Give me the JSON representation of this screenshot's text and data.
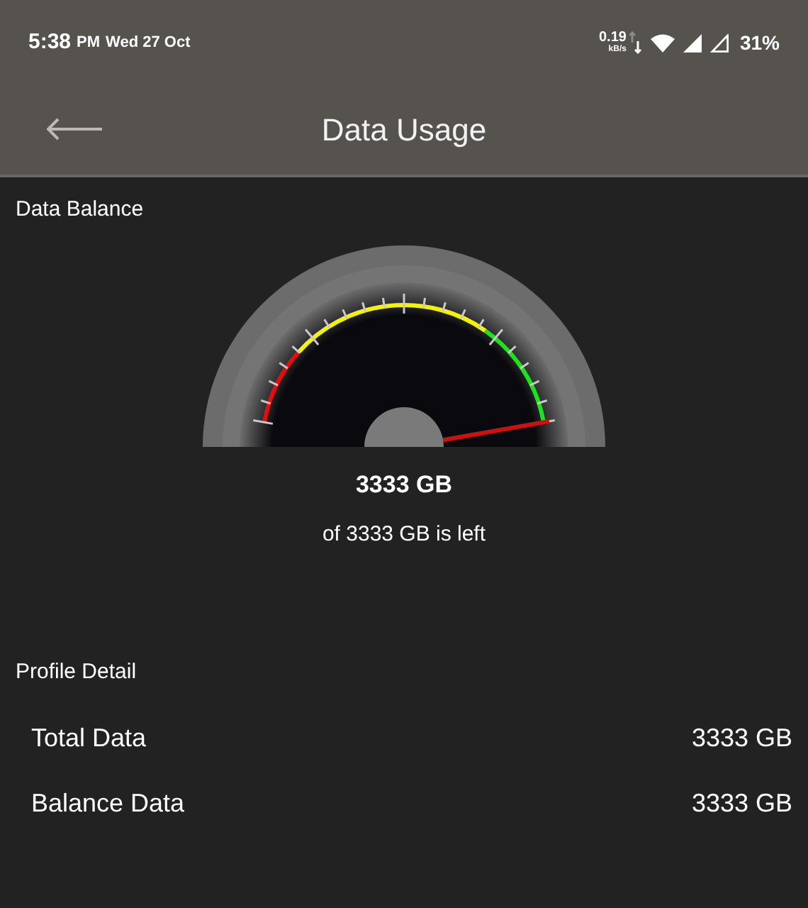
{
  "status_bar": {
    "time": "5:38",
    "ampm": "PM",
    "date": "Wed 27 Oct",
    "speed": "0.19",
    "speed_unit": "kB/s",
    "battery": "31%"
  },
  "app_bar": {
    "title": "Data Usage"
  },
  "data_balance": {
    "heading": "Data Balance",
    "amount": "3333 GB",
    "caption": "of 3333 GB is left"
  },
  "profile_detail": {
    "heading": "Profile Detail",
    "rows": [
      {
        "label": "Total Data",
        "value": "3333 GB"
      },
      {
        "label": "Balance Data",
        "value": "3333 GB"
      }
    ]
  }
}
